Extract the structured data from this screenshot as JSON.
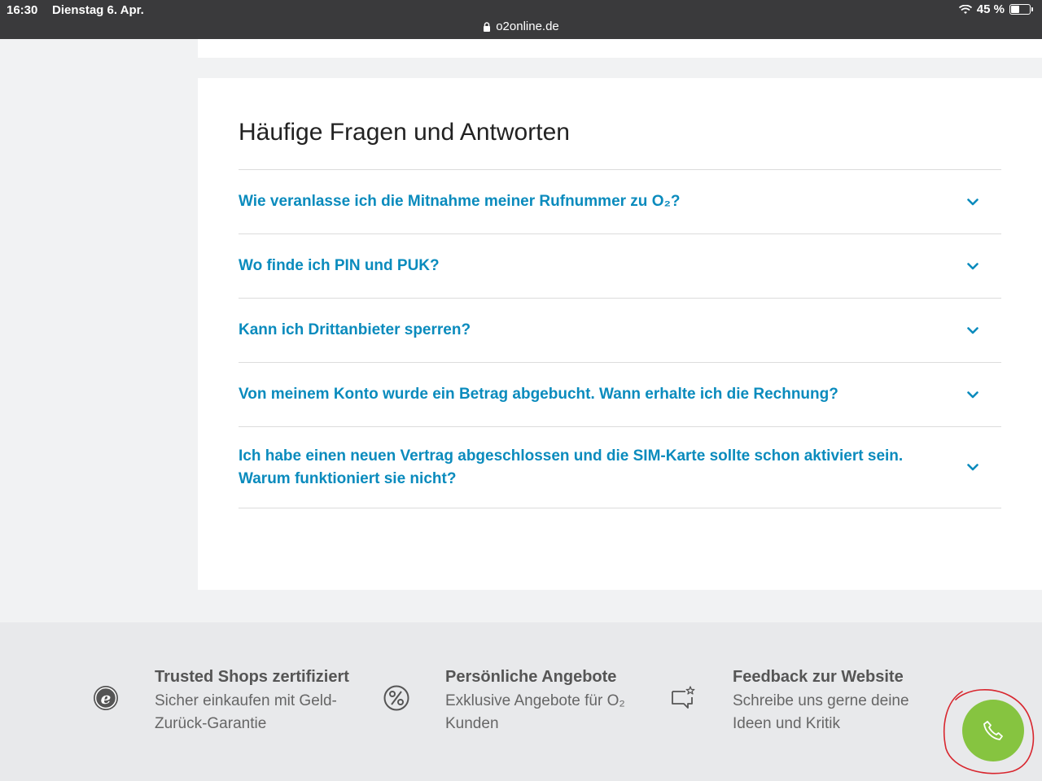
{
  "status_bar": {
    "time": "16:30",
    "date": "Dienstag 6. Apr.",
    "battery": "45 %",
    "battery_level": 0.45,
    "url": "o2online.de"
  },
  "faq": {
    "title": "Häufige Fragen und Antworten",
    "items": [
      {
        "question": "Wie veranlasse ich die Mitnahme meiner Rufnummer zu O₂?"
      },
      {
        "question": "Wo finde ich PIN und PUK?"
      },
      {
        "question": "Kann ich Drittanbieter sperren?"
      },
      {
        "question": "Von meinem Konto wurde ein Betrag abgebucht. Wann erhalte ich die Rechnung?"
      },
      {
        "question": "Ich habe einen neuen Vertrag abgeschlossen und die SIM-Karte sollte schon aktiviert sein. Warum funktioniert sie nicht?"
      }
    ]
  },
  "footer": {
    "features": [
      {
        "icon": "trusted-shops-icon",
        "title": "Trusted Shops zertifiziert",
        "line1": "Sicher einkaufen mit Geld-",
        "line2": "Zurück-Garantie"
      },
      {
        "icon": "percent-icon",
        "title": "Persönliche Angebote",
        "line1": "Exklusive Angebote für O₂",
        "line2": "Kunden"
      },
      {
        "icon": "feedback-icon",
        "title": "Feedback zur Website",
        "line1": "Schreibe uns gerne deine",
        "line2": "Ideen und Kritik"
      }
    ]
  },
  "colors": {
    "link": "#0a8bbd",
    "call_button": "#86c440",
    "annotation": "#d8262e"
  }
}
